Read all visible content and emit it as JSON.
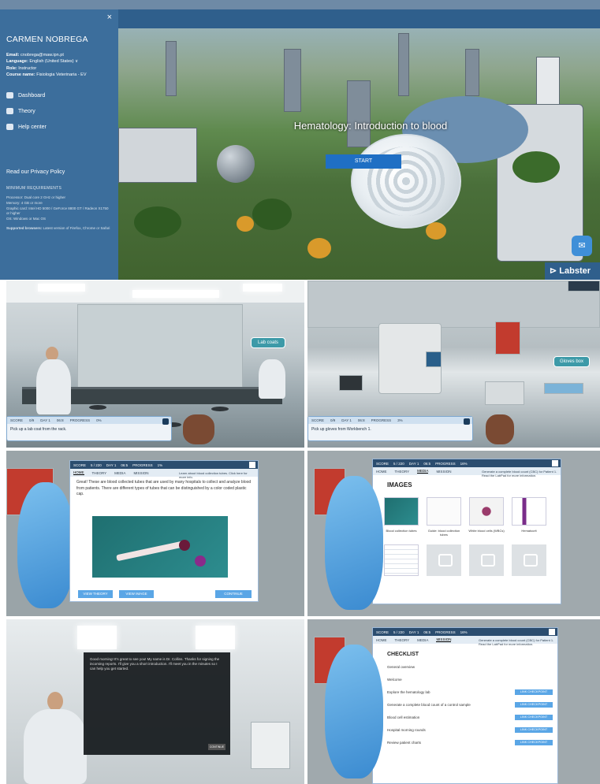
{
  "sidebar": {
    "close_label": "×",
    "user_name": "CARMEN NOBREGA",
    "email_label": "Email:",
    "email_value": "cnobrega@maw.ipn.pt",
    "language_label": "Language:",
    "language_value": "English (United States) ∨",
    "role_label": "Role:",
    "role_value": "Instructor",
    "course_label": "Course name:",
    "course_value": "Fisiologia Veterinaria - EV",
    "nav": [
      {
        "label": "Dashboard",
        "icon": "cap-icon"
      },
      {
        "label": "Theory",
        "icon": "book-icon"
      },
      {
        "label": "Help center",
        "icon": "chat-icon"
      }
    ],
    "privacy": "Read our Privacy Policy",
    "min_req_title": "MINIMUM REQUIREMENTS",
    "requirements": [
      "Processor: Dual core 2 GHz or higher",
      "Memory: 4 GB or more",
      "Graphic card: Intel HD 5000 / GeForce 8800 GT / Radeon X1750 or higher",
      "OS: Windows or Mac OS"
    ],
    "supported_label": "Supported browsers:",
    "supported_value": "Latest version of Firefox, Chrome or Safari"
  },
  "launch": {
    "title": "Hematology: Introduction to blood",
    "start_button": "START",
    "brand": "Labster",
    "chat_icon": "chat-bubble-icon"
  },
  "scene_lab_left": {
    "sign": "Lab coats",
    "taskbar_fields": [
      "SCORE",
      "0/9",
      "DAY 1",
      "06:8",
      "PROGRESS",
      "0%"
    ],
    "instruction": "Pick up a lab coat from the rack."
  },
  "scene_lab_right": {
    "sign": "Gloves box",
    "taskbar_fields": [
      "SCORE",
      "0/9",
      "DAY 1",
      "06:8",
      "PROGRESS",
      "3%"
    ],
    "instruction": "Pick up gloves from Workbench 1."
  },
  "theory_dialog": {
    "header": [
      "SCORE",
      "5 / 220",
      "DAY 1",
      "06:5",
      "PROGRESS",
      "1%"
    ],
    "header_note": "Learn about blood collection tubes. Click here for more info.",
    "tabs": [
      "HOME",
      "THEORY",
      "MEDIA",
      "MISSION"
    ],
    "active_tab": "HOME",
    "body": "Great! These are blood collected tubes that are used by many hospitals to collect and analyze blood from patients. There are different types of tubes that can be distinguished by a color coded plastic cap.",
    "buttons": [
      "VIEW THEORY",
      "VIEW IMAGE",
      "CONTINUE"
    ]
  },
  "media_dialog": {
    "header": [
      "SCORE",
      "5 / 220",
      "DAY 1",
      "06:5",
      "PROGRESS",
      "16%"
    ],
    "header_note": "Generate a complete blood count (CBC) for Patient 1. Read the LabPad for more information.",
    "tabs": [
      "HOME",
      "THEORY",
      "MEDIA",
      "MISSION"
    ],
    "active_tab": "MEDIA",
    "section_title": "IMAGES",
    "captions": [
      "Blood collection tubes",
      "Guide: blood collection tubes",
      "White blood cells (WBCs)",
      "Hematocrit"
    ]
  },
  "intro_dialog": {
    "text": "Good morning! It's great to see you! My name is Dr. Collins. Thanks for signing the incoming reports. I'll give you a short introduction. I'll meet you in the minutes so I can help you get started.",
    "button": "CONTINUE"
  },
  "mission_dialog": {
    "header": [
      "SCORE",
      "5 / 220",
      "DAY 1",
      "06:5",
      "PROGRESS",
      "16%"
    ],
    "header_note": "Generate a complete blood count (CBC) for Patient 1. Read the LabPad for more information.",
    "tabs": [
      "HOME",
      "THEORY",
      "MEDIA",
      "MISSION"
    ],
    "active_tab": "MISSION",
    "section_title": "CHECKLIST",
    "items": [
      {
        "label": "General overview",
        "button": ""
      },
      {
        "label": "Welcome",
        "button": ""
      },
      {
        "label": "Explore the hematology lab",
        "button": "LINK CHECKPOINT"
      },
      {
        "label": "Generate a complete blood count of a control sample",
        "button": "LINK CHECKPOINT"
      },
      {
        "label": "Blood cell estimation",
        "button": "LINK CHECKPOINT"
      },
      {
        "label": "Hospital morning rounds",
        "button": "LINK CHECKPOINT"
      },
      {
        "label": "Review patient charts",
        "button": "LINK CHECKPOINT"
      }
    ]
  }
}
